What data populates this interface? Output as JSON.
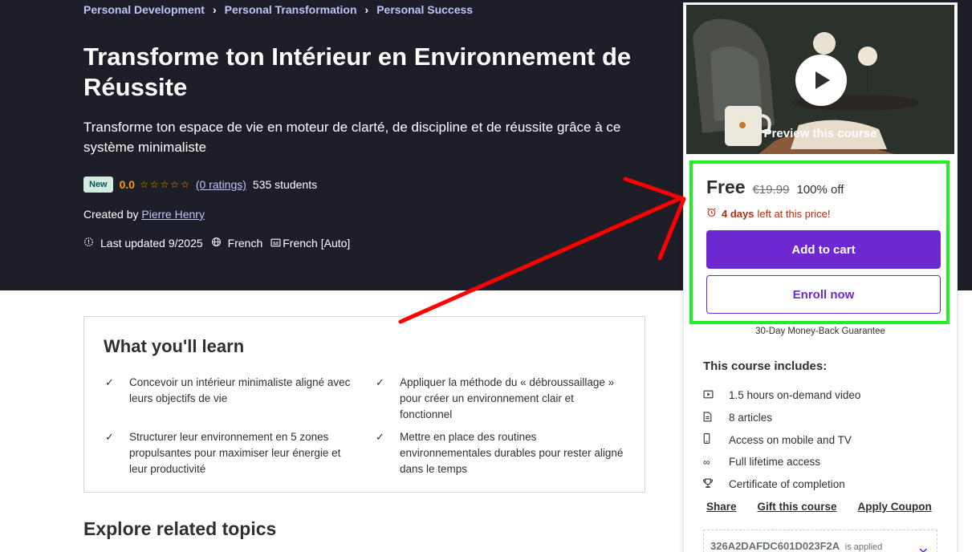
{
  "breadcrumb": [
    "Personal Development",
    "Personal Transformation",
    "Personal Success"
  ],
  "course": {
    "title": "Transforme ton Intérieur en Environnement de Réussite",
    "subtitle": "Transforme ton espace de vie en moteur de clarté, de discipline et de réussite grâce à ce système minimaliste",
    "badge": "New",
    "rating": "0.0",
    "ratings_count": "(0 ratings)",
    "students": "535 students",
    "created_by_label": "Created by",
    "author": "Pierre Henry",
    "last_updated": "Last updated 9/2025",
    "language": "French",
    "captions": "French [Auto]"
  },
  "learn": {
    "heading": "What you'll learn",
    "items": [
      "Concevoir un intérieur minimaliste aligné avec leurs objectifs de vie",
      "Appliquer la méthode du « débroussaillage » pour créer un environnement clair et fonctionnel",
      "Structurer leur environnement en 5 zones propulsantes pour maximiser leur énergie et leur productivité",
      "Mettre en place des routines environnementales durables pour rester aligné dans le temps"
    ]
  },
  "explore_heading": "Explore related topics",
  "sidebar": {
    "preview_label": "Preview this course",
    "price": "Free",
    "original_price": "€19.99",
    "discount": "100% off",
    "timer_bold": "4 days",
    "timer_text": "left at this price!",
    "add_to_cart": "Add to cart",
    "enroll_now": "Enroll now",
    "guarantee": "30-Day Money-Back Guarantee",
    "includes_title": "This course includes:",
    "includes": [
      {
        "icon": "video-icon",
        "text": "1.5 hours on-demand video"
      },
      {
        "icon": "article-icon",
        "text": "8 articles"
      },
      {
        "icon": "mobile-icon",
        "text": "Access on mobile and TV"
      },
      {
        "icon": "infinity-icon",
        "text": "Full lifetime access"
      },
      {
        "icon": "trophy-icon",
        "text": "Certificate of completion"
      }
    ],
    "links": [
      "Share",
      "Gift this course",
      "Apply Coupon"
    ],
    "coupon_code": "326A2DAFDC601D023F2A",
    "coupon_status": "is applied"
  },
  "colors": {
    "hero_bg": "#1d1e27",
    "accent_purple": "#6d28d2",
    "rating_orange": "#f69c08",
    "highlight_green": "#1ff01f",
    "annotation_red": "#ff0000",
    "timer_red": "#b32d0f"
  }
}
